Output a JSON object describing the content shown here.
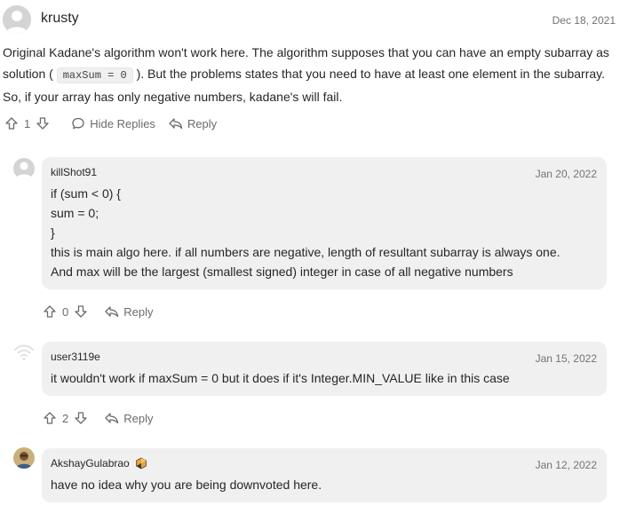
{
  "main_comment": {
    "username": "krusty",
    "date": "Dec 18, 2021",
    "text_part1": "Original Kadane's algorithm won't work here. The algorithm supposes that you can have an empty subarray as solution ( ",
    "code": "maxSum = 0",
    "text_part2": " ). But the problems states that you need to have at least one element in the subarray. So, if your array has only negative numbers, kadane's will fail.",
    "votes": "1",
    "hide_replies_label": "Hide Replies",
    "reply_label": "Reply"
  },
  "replies": [
    {
      "username": "killShot91",
      "date": "Jan 20, 2022",
      "lines": [
        "if (sum < 0) {",
        "sum = 0;",
        "}",
        "this is main algo here. if all numbers are negative, length of resultant subarray is always one.",
        "And max will be the largest (smallest signed) integer in case of all negative numbers"
      ],
      "votes": "0",
      "reply_label": "Reply"
    },
    {
      "username": "user3119e",
      "date": "Jan 15, 2022",
      "lines": [
        "it wouldn't work if maxSum = 0 but it does if it's Integer.MIN_VALUE like in this case"
      ],
      "votes": "2",
      "reply_label": "Reply"
    },
    {
      "username": "AkshayGulabrao",
      "date": "Jan 12, 2022",
      "lines": [
        "have no idea why you are being downvoted here."
      ]
    }
  ],
  "colors": {
    "reply_bg": "#f0f0f0",
    "muted_text": "#737373",
    "badge": "#e8a33d"
  }
}
